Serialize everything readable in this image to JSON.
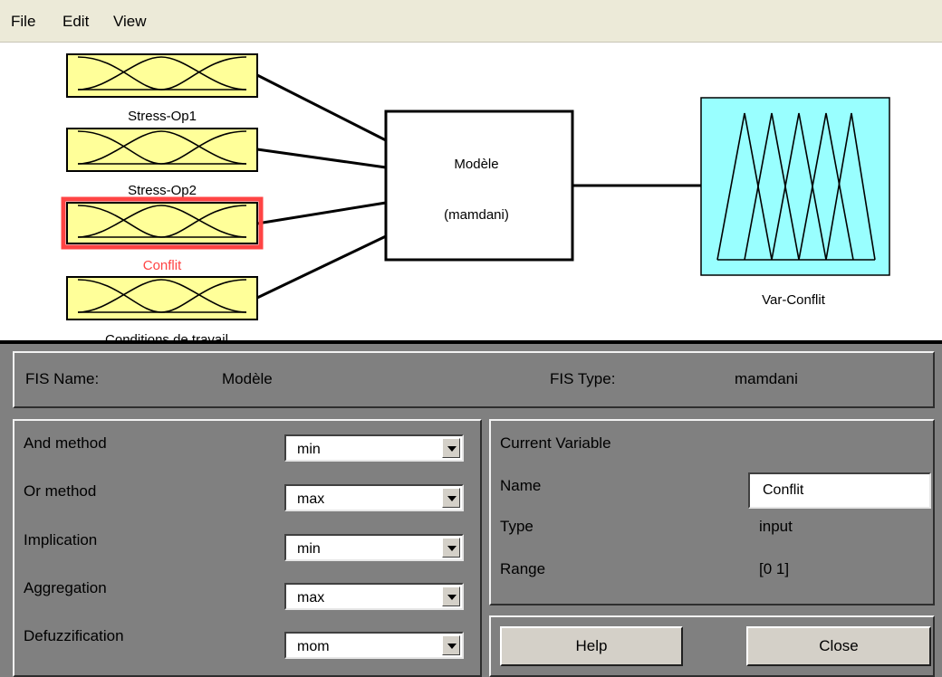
{
  "menu": {
    "file": "File",
    "edit": "Edit",
    "view": "View"
  },
  "diagram": {
    "inputs": [
      {
        "name": "Stress-Op1",
        "selected": false
      },
      {
        "name": "Stress-Op2",
        "selected": false
      },
      {
        "name": "Conflit",
        "selected": true
      },
      {
        "name": "Conditions de travail",
        "selected": false
      }
    ],
    "model_name": "Modèle",
    "model_type": "(mamdani)",
    "output_name": "Var-Conflit",
    "colors": {
      "input_fill": "#ffff99",
      "output_fill": "#99ffff",
      "selected": "#ff4444"
    }
  },
  "fis": {
    "name_label": "FIS Name:",
    "name_value": "Modèle",
    "type_label": "FIS Type:",
    "type_value": "mamdani"
  },
  "methods": {
    "and_label": "And method",
    "and_value": "min",
    "or_label": "Or method",
    "or_value": "max",
    "impl_label": "Implication",
    "impl_value": "min",
    "agg_label": "Aggregation",
    "agg_value": "max",
    "defuzz_label": "Defuzzification",
    "defuzz_value": "mom"
  },
  "current": {
    "title": "Current Variable",
    "name_label": "Name",
    "name_value": "Conflit",
    "type_label": "Type",
    "type_value": "input",
    "range_label": "Range",
    "range_value": "[0 1]"
  },
  "buttons": {
    "help": "Help",
    "close": "Close"
  }
}
